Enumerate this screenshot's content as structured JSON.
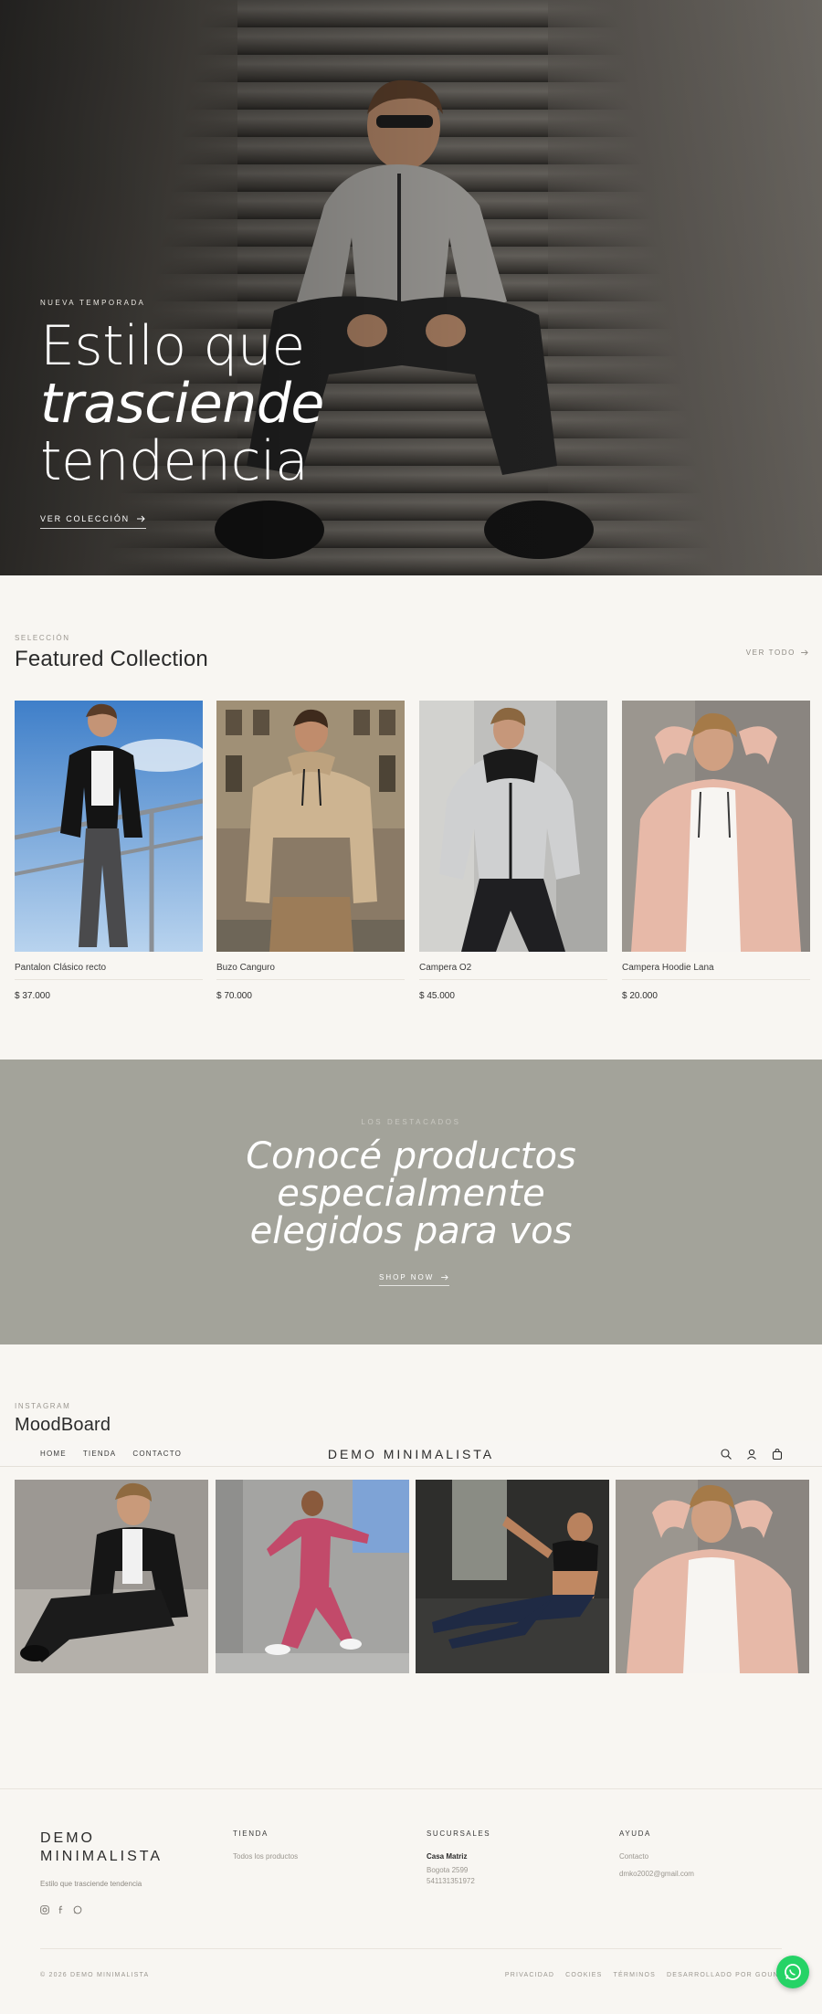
{
  "hero": {
    "eyebrow": "NUEVA TEMPORADA",
    "title_line1": "Estilo que",
    "title_line2": "trasciende",
    "title_line3": "tendencia",
    "cta_label": "VER COLECCIÓN"
  },
  "featured": {
    "eyebrow": "SELECCIÓN",
    "title": "Featured Collection",
    "view_all_label": "VER TODO",
    "products": [
      {
        "name": "Pantalon Clásico recto",
        "price": "$ 37.000"
      },
      {
        "name": "Buzo Canguro",
        "price": "$ 70.000"
      },
      {
        "name": "Campera O2",
        "price": "$ 45.000"
      },
      {
        "name": "Campera Hoodie Lana",
        "price": "$ 20.000"
      }
    ]
  },
  "banner": {
    "eyebrow": "LOS DESTACADOS",
    "heading_line1": "Conocé productos",
    "heading_line2": "especialmente",
    "heading_line3": "elegidos para vos",
    "cta_label": "SHOP NOW"
  },
  "moodboard": {
    "eyebrow": "INSTAGRAM",
    "title": "MoodBoard"
  },
  "nav": {
    "links": [
      "HOME",
      "TIENDA",
      "CONTACTO"
    ],
    "brand": "DEMO MINIMALISTA",
    "icons": [
      "search-icon",
      "user-icon",
      "cart-icon"
    ]
  },
  "footer": {
    "brand_line1": "DEMO",
    "brand_line2": "MINIMALISTA",
    "tagline": "Estilo que trasciende tendencia",
    "social_icons": [
      "instagram-icon",
      "facebook-icon",
      "whatsapp-icon"
    ],
    "tienda_heading": "TIENDA",
    "tienda_link": "Todos los productos",
    "sucursales_heading": "SUCURSALES",
    "branch_name": "Casa Matriz",
    "branch_address": "Bogota 2599",
    "branch_phone": "541131351972",
    "ayuda_heading": "AYUDA",
    "contact_link": "Contacto",
    "email": "dmko2002@gmail.com",
    "copyright": "© 2026 DEMO MINIMALISTA",
    "legal_links": [
      "PRIVACIDAD",
      "COOKIES",
      "TÉRMINOS",
      "DESARROLLADO POR GOUNI"
    ]
  },
  "colors": {
    "page_background": "#f8f6f2",
    "banner_background": "#a3a39a",
    "whatsapp_green": "#25d366",
    "text_dark": "#2b2b2b",
    "text_muted": "#9a968f"
  }
}
